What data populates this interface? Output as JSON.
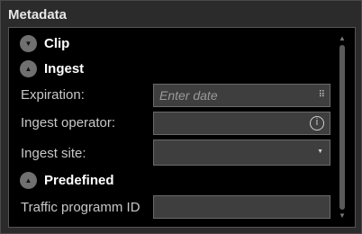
{
  "panel": {
    "title": "Metadata"
  },
  "sections": {
    "clip": {
      "label": "Clip"
    },
    "ingest": {
      "label": "Ingest"
    },
    "predefined": {
      "label": "Predefined"
    }
  },
  "fields": {
    "expiration": {
      "label": "Expiration:",
      "placeholder": "Enter date",
      "value": ""
    },
    "ingest_operator": {
      "label": "Ingest operator:",
      "value": ""
    },
    "ingest_site": {
      "label": "Ingest site:",
      "value": ""
    },
    "traffic_program_id": {
      "label": "Traffic programm ID",
      "value": ""
    }
  },
  "icons": {
    "clip_toggle": "chevron-down-icon",
    "ingest_toggle": "chevron-up-icon",
    "predefined_toggle": "chevron-up-icon",
    "calendar": "calendar-icon",
    "info": "info-icon",
    "dropdown": "dropdown-arrow-icon"
  }
}
